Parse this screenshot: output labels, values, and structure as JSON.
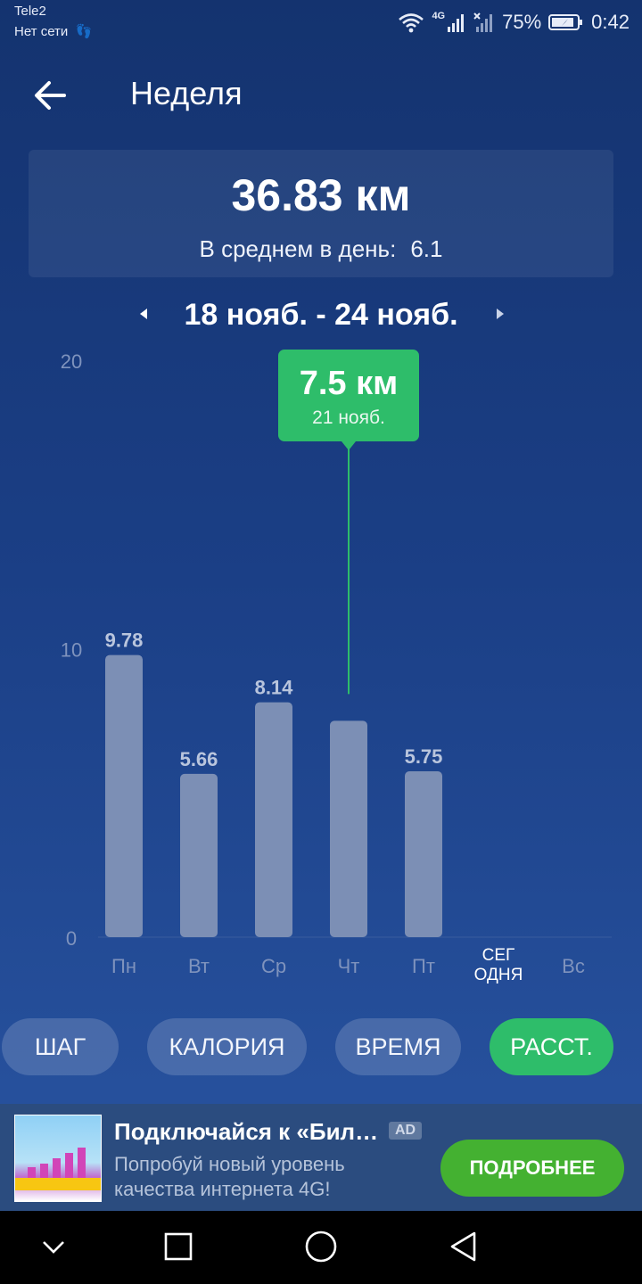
{
  "status_bar": {
    "carrier": "Tele2",
    "network": "Нет сети",
    "battery": "75%",
    "time": "0:42",
    "network_type": "4G"
  },
  "header": {
    "title": "Неделя"
  },
  "summary": {
    "total": "36.83 км",
    "avg_label": "В среднем в день:",
    "avg_value": "6.1"
  },
  "range": {
    "label": "18 нояб. - 24 нояб."
  },
  "tooltip": {
    "value": "7.5 км",
    "date": "21 нояб.",
    "index": 3
  },
  "chart_data": {
    "type": "bar",
    "categories": [
      "Пн",
      "Вт",
      "Ср",
      "Чт",
      "Пт",
      "СЕГ\nОДНЯ",
      "Вс"
    ],
    "values": [
      9.78,
      5.66,
      8.14,
      7.5,
      5.75,
      0,
      0
    ],
    "data_labels": [
      "9.78",
      "5.66",
      "8.14",
      "",
      "5.75",
      "",
      ""
    ],
    "ylim": [
      0,
      20
    ],
    "yticks": [
      0,
      10,
      20
    ],
    "highlight_index": 3,
    "grid": false
  },
  "tabs": [
    {
      "label": "ШАГ",
      "active": false
    },
    {
      "label": "КАЛОРИЯ",
      "active": false
    },
    {
      "label": "ВРЕМЯ",
      "active": false
    },
    {
      "label": "РАССТ.",
      "active": true
    }
  ],
  "ad": {
    "title": "Подключайся к «Бил…",
    "badge": "AD",
    "body": "Попробуй новый уровень качества интернета 4G!",
    "cta": "ПОДРОБНЕЕ"
  },
  "colors": {
    "accent_green": "#2ebd6a",
    "bar": "#7c8fb5",
    "ad_cta": "#44b131"
  }
}
